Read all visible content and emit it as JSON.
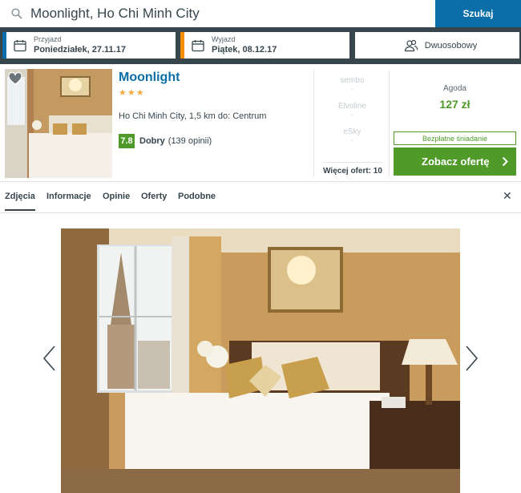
{
  "search": {
    "query": "Moonlight, Ho Chi Minh City",
    "button": "Szukaj"
  },
  "checkin": {
    "label": "Przyjazd",
    "value": "Poniedziałek, 27.11.17"
  },
  "checkout": {
    "label": "Wyjazd",
    "value": "Piątek, 08.12.17"
  },
  "room": {
    "value": "Dwuosobowy"
  },
  "hotel": {
    "name": "Moonlight",
    "stars": "★★★",
    "location": "Ho Chi Minh City, 1,5 km do: Centrum",
    "score": "7.8",
    "score_word": "Dobry",
    "reviews": "(139 opinii)"
  },
  "deals": [
    {
      "provider": "sembo",
      "price": "-"
    },
    {
      "provider": "Elvoline",
      "price": "-"
    },
    {
      "provider": "eSky",
      "price": "-"
    }
  ],
  "more_offers": "Więcej ofert: 10",
  "best": {
    "provider": "Agoda",
    "price": "127 zł",
    "badge": "Bezpłatne śniadanie",
    "cta": "Zobacz ofertę"
  },
  "tabs": [
    "Zdjęcia",
    "Informacje",
    "Opinie",
    "Oferty",
    "Podobne"
  ],
  "colors": {
    "accent": "#0a6fa8",
    "checkout_accent": "#f48f00",
    "green": "#4f9a29",
    "topbar": "#37454d"
  },
  "icons": [
    "search-icon",
    "calendar-icon",
    "people-icon",
    "heart-icon",
    "chevron-right-icon",
    "close-icon",
    "chevron-left-icon"
  ]
}
